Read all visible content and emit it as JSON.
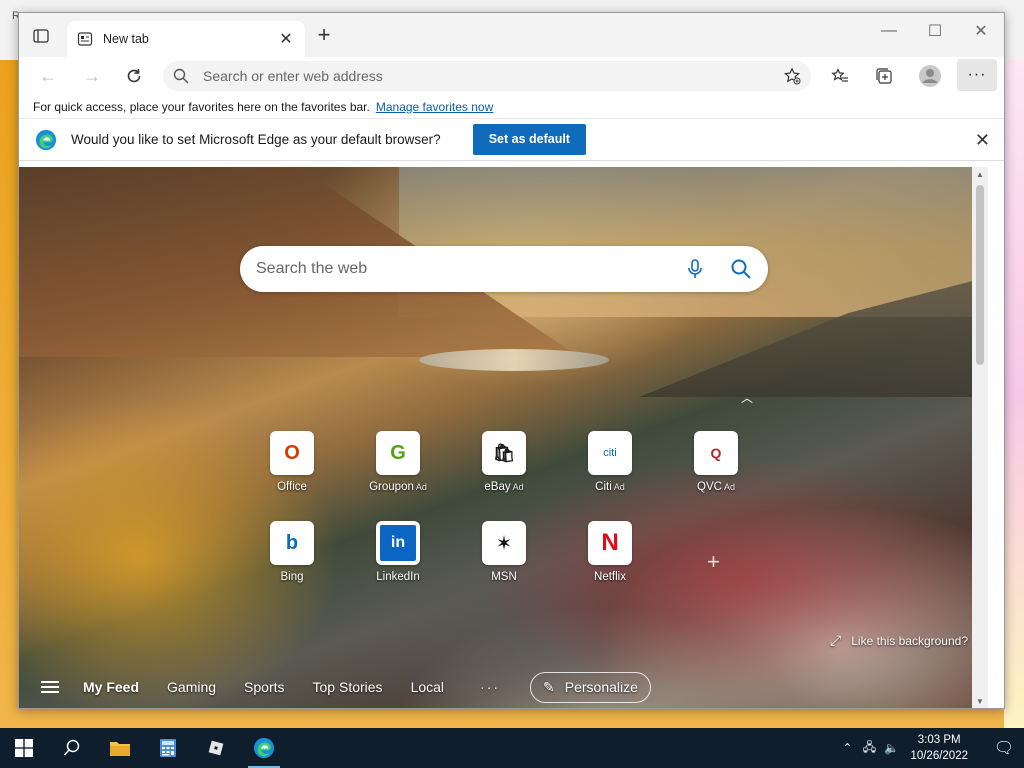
{
  "desktop": {
    "corner_letter": "R"
  },
  "browser": {
    "tab": {
      "title": "New tab"
    },
    "new_tab_symbol": "+",
    "window_controls": {
      "minimize": "—",
      "maximize": "☐",
      "close": "✕"
    },
    "address": {
      "placeholder": "Search or enter web address"
    },
    "more_symbol": "···",
    "favorites_bar": {
      "message": "For quick access, place your favorites here on the favorites bar.",
      "link": "Manage favorites now"
    },
    "default_prompt": {
      "message": "Would you like to set Microsoft Edge as your default browser?",
      "button": "Set as default"
    }
  },
  "new_tab_page": {
    "search": {
      "placeholder": "Search the web"
    },
    "tiles_row1": [
      {
        "label": "Office",
        "ad": "",
        "glyph": "O",
        "color": "#d83b01"
      },
      {
        "label": "Groupon",
        "ad": "Ad",
        "glyph": "G",
        "color": "#53a318"
      },
      {
        "label": "eBay",
        "ad": "Ad",
        "glyph": "🛍",
        "color": "#e53238"
      },
      {
        "label": "Citi",
        "ad": "Ad",
        "glyph": "citi",
        "color": "#056dae"
      },
      {
        "label": "QVC",
        "ad": "Ad",
        "glyph": "Q",
        "color": "#b0272d"
      }
    ],
    "tiles_row2": [
      {
        "label": "Bing",
        "ad": "",
        "glyph": "b",
        "color": "#0f6cbd"
      },
      {
        "label": "LinkedIn",
        "ad": "",
        "glyph": "in",
        "color": "#0a66c2"
      },
      {
        "label": "MSN",
        "ad": "",
        "glyph": "✶",
        "color": "#111111"
      },
      {
        "label": "Netflix",
        "ad": "",
        "glyph": "N",
        "color": "#e50914"
      }
    ],
    "add_tile_symbol": "+",
    "like_background": "Like this background?",
    "feed": {
      "items": [
        "My Feed",
        "Gaming",
        "Sports",
        "Top Stories",
        "Local"
      ],
      "more": "···",
      "personalize": "Personalize"
    }
  },
  "taskbar": {
    "clock": {
      "time": "3:03 PM",
      "date": "10/26/2022"
    },
    "accent": "#76b9ed"
  }
}
